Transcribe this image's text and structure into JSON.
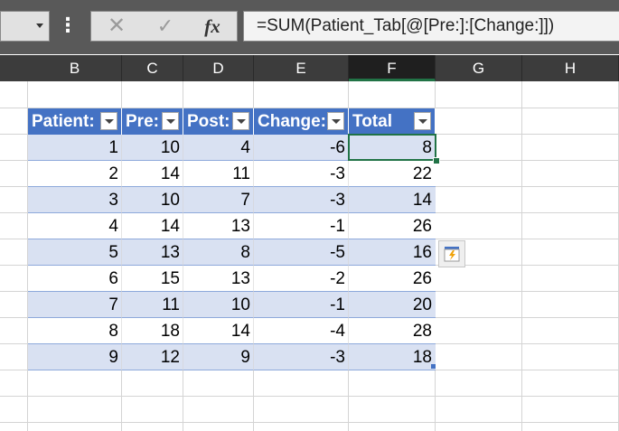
{
  "formula_bar": {
    "name_box_icon": "chevron-down-icon",
    "more_icon": "vertical-dots-icon",
    "cancel_glyph": "✕",
    "enter_glyph": "✓",
    "fx_label": "fx",
    "formula": "=SUM(Patient_Tab[@[Pre:]:[Change:]])"
  },
  "columns": [
    {
      "label": "B",
      "selected": false
    },
    {
      "label": "C",
      "selected": false
    },
    {
      "label": "D",
      "selected": false
    },
    {
      "label": "E",
      "selected": false
    },
    {
      "label": "F",
      "selected": true
    },
    {
      "label": "G",
      "selected": false
    },
    {
      "label": "H",
      "selected": false
    }
  ],
  "table": {
    "headers": [
      "Patient:",
      "Pre:",
      "Post:",
      "Change:",
      "Total"
    ],
    "rows": [
      [
        "1",
        "10",
        "4",
        "-6",
        "8"
      ],
      [
        "2",
        "14",
        "11",
        "-3",
        "22"
      ],
      [
        "3",
        "10",
        "7",
        "-3",
        "14"
      ],
      [
        "4",
        "14",
        "13",
        "-1",
        "26"
      ],
      [
        "5",
        "13",
        "8",
        "-5",
        "16"
      ],
      [
        "6",
        "15",
        "13",
        "-2",
        "26"
      ],
      [
        "7",
        "11",
        "10",
        "-1",
        "20"
      ],
      [
        "8",
        "18",
        "14",
        "-4",
        "28"
      ],
      [
        "9",
        "12",
        "9",
        "-3",
        "18"
      ]
    ]
  },
  "flash_fill_icon": "lightning-icon",
  "colors": {
    "header_fill": "#4472c4",
    "band_fill": "#d9e1f2",
    "selection": "#217346"
  }
}
